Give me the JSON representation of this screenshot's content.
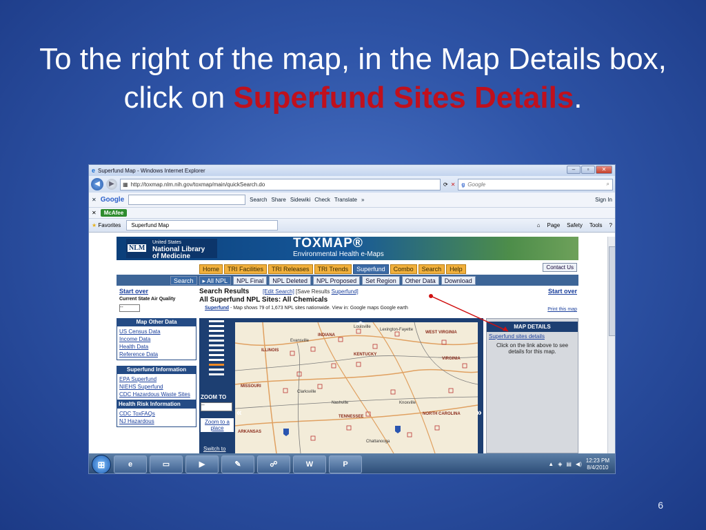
{
  "slide": {
    "title_part1": "To the right of the map, in the Map Details box, click on ",
    "title_highlight": "Superfund Sites Details",
    "title_end": ".",
    "page_number": "6"
  },
  "browser": {
    "window_title": "Superfund Map - Windows Internet Explorer",
    "url": "http://toxmap.nlm.nih.gov/toxmap/main/quickSearch.do",
    "search_placeholder": "Google",
    "google_toolbar": {
      "logo": "Google",
      "items": [
        "Search",
        "Share",
        "Sidewiki",
        "Check",
        "Translate",
        "»",
        "Sign In"
      ]
    },
    "mcafee_label": "McAfee",
    "favorites_label": "Favorites",
    "tab_label": "Superfund Map",
    "command_items": [
      "Page",
      "Safety",
      "Tools"
    ]
  },
  "site": {
    "nlm_line1": "United States",
    "nlm_line2": "National Library",
    "nlm_line3": "of Medicine",
    "nlm_logo": "NLM",
    "toxmap_title": "TOXMAP®",
    "toxmap_subtitle": "Environmental Health e-Maps",
    "main_tabs": [
      "Home",
      "TRI Facilities",
      "TRI Releases",
      "TRI Trends",
      "Superfund",
      "Combo",
      "Search",
      "Help"
    ],
    "contact_us": "Contact Us",
    "sub_tabs": [
      "Search",
      "▸ All NPL",
      "NPL Final",
      "NPL Deleted",
      "NPL Proposed",
      "Set Region",
      "Other Data",
      "Download"
    ],
    "start_over": "Start over",
    "current_air": "Current State Air Quality",
    "air_select": "--",
    "search_results": "Search Results",
    "edit_search": "[Edit Search]",
    "save_results": "[Save Results",
    "superfund_link": "Superfund]",
    "all_npl": "All Superfund NPL Sites: All Chemicals",
    "map_shows_link": "Superfund",
    "map_shows_text": " - Map shows 79 of 1,673 NPL sites nationwide. View in: Google maps  Google earth",
    "print_map": "Print this map",
    "map_other_data_h": "Map Other Data",
    "map_other_data": [
      "US Census Data",
      "Income Data",
      "Health Data",
      "Reference Data"
    ],
    "superfund_info_h": "Superfund Information",
    "superfund_info": [
      "EPA Superfund",
      "NIEHS Superfund",
      "CDC Hazardous Waste Sites"
    ],
    "health_risk_h": "Health Risk Information",
    "health_risk": [
      "CDC ToxFAQs",
      "NJ Hazardous"
    ],
    "zoom_to": "ZOOM TO",
    "zoom_select": "--",
    "zoom_place": "Zoom to a place",
    "switch_to": "Switch to",
    "map_labels": [
      "Louisville",
      "Lexington-Fayette",
      "WEST VIRGINIA",
      "INDIANA",
      "Evansville",
      "ILLINOIS",
      "KENTUCKY",
      "VIRGINIA",
      "MISSOURI",
      "Clarksville",
      "Nashville",
      "Knoxville",
      "NORTH CAROLINA",
      "TENNESSEE",
      "ARKANSAS",
      "Chattanooga"
    ],
    "map_details_h": "MAP DETAILS",
    "superfund_sites_details": "Superfund sites details",
    "details_note": "Click on the link above to see details for this map."
  },
  "taskbar": {
    "time": "12:23 PM",
    "date": "8/4/2010"
  }
}
